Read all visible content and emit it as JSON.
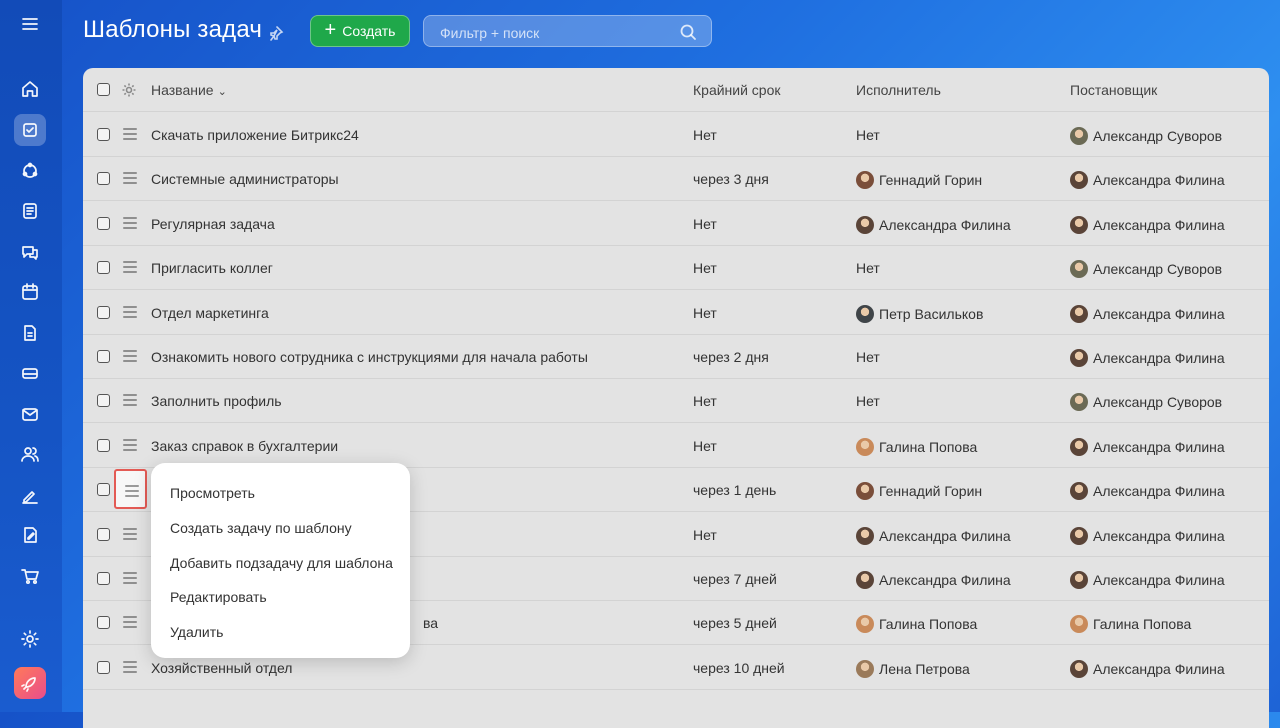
{
  "page": {
    "title": "Шаблоны задач",
    "create_label": "Создать",
    "create_plus": "+",
    "search_placeholder": "Фильтр + поиск"
  },
  "sidebar": {
    "icons": [
      "menu-icon",
      "home-icon",
      "tasks-icon",
      "groups-icon",
      "feed-icon",
      "chat-icon",
      "calendar-icon",
      "documents-icon",
      "drive-icon",
      "mail-icon",
      "contacts-icon",
      "sign-icon",
      "forms-icon",
      "shop-icon",
      "settings-icon",
      "rocket-icon"
    ]
  },
  "table": {
    "headers": {
      "name": "Название",
      "deadline": "Крайний срок",
      "responsible": "Исполнитель",
      "creator": "Постановщик"
    },
    "rows": [
      {
        "name": "Скачать приложение Битрикс24",
        "deadline": "Нет",
        "responsible": "Нет",
        "responsible_avatar": "",
        "creator": "Александр Суворов",
        "creator_avatar": "#6b6a55"
      },
      {
        "name": "Системные администраторы",
        "deadline": "через 3 дня",
        "responsible": "Геннадий Горин",
        "responsible_avatar": "#7a4e3a",
        "creator": "Александра Филина",
        "creator_avatar": "#5a4438"
      },
      {
        "name": "Регулярная задача",
        "deadline": "Нет",
        "responsible": "Александра Филина",
        "responsible_avatar": "#5a4438",
        "creator": "Александра Филина",
        "creator_avatar": "#5a4438"
      },
      {
        "name": "Пригласить коллег",
        "deadline": "Нет",
        "responsible": "Нет",
        "responsible_avatar": "",
        "creator": "Александр Суворов",
        "creator_avatar": "#6b6a55"
      },
      {
        "name": "Отдел маркетинга",
        "deadline": "Нет",
        "responsible": "Петр Васильков",
        "responsible_avatar": "#3f4448",
        "creator": "Александра Филина",
        "creator_avatar": "#5a4438"
      },
      {
        "name": "Ознакомить нового сотрудника с инструкциями для начала работы",
        "deadline": "через 2 дня",
        "responsible": "Нет",
        "responsible_avatar": "",
        "creator": "Александра Филина",
        "creator_avatar": "#5a4438"
      },
      {
        "name": "Заполнить профиль",
        "deadline": "Нет",
        "responsible": "Нет",
        "responsible_avatar": "",
        "creator": "Александр Суворов",
        "creator_avatar": "#6b6a55"
      },
      {
        "name": "Заказ справок в бухгалтерии",
        "deadline": "Нет",
        "responsible": "Галина Попова",
        "responsible_avatar": "#c98a5a",
        "creator": "Александра Филина",
        "creator_avatar": "#5a4438"
      },
      {
        "name": "",
        "deadline": "через 1 день",
        "responsible": "Геннадий Горин",
        "responsible_avatar": "#7a4e3a",
        "creator": "Александра Филина",
        "creator_avatar": "#5a4438"
      },
      {
        "name": "",
        "deadline": "Нет",
        "responsible": "Александра Филина",
        "responsible_avatar": "#5a4438",
        "creator": "Александра Филина",
        "creator_avatar": "#5a4438"
      },
      {
        "name": "",
        "deadline": "через 7 дней",
        "responsible": "Александра Филина",
        "responsible_avatar": "#5a4438",
        "creator": "Александра Филина",
        "creator_avatar": "#5a4438"
      },
      {
        "name": "ва",
        "deadline": "через 5 дней",
        "responsible": "Галина Попова",
        "responsible_avatar": "#c98a5a",
        "creator": "Галина Попова",
        "creator_avatar": "#c98a5a"
      },
      {
        "name": "Хозяйственный отдел",
        "deadline": "через 10 дней",
        "responsible": "Лена Петрова",
        "responsible_avatar": "#9a7a5a",
        "creator": "Александра Филина",
        "creator_avatar": "#5a4438"
      }
    ]
  },
  "context_menu": {
    "items": [
      "Просмотреть",
      "Создать задачу по шаблону",
      "Добавить подзадачу для шаблона",
      "Редактировать",
      "Удалить"
    ]
  }
}
